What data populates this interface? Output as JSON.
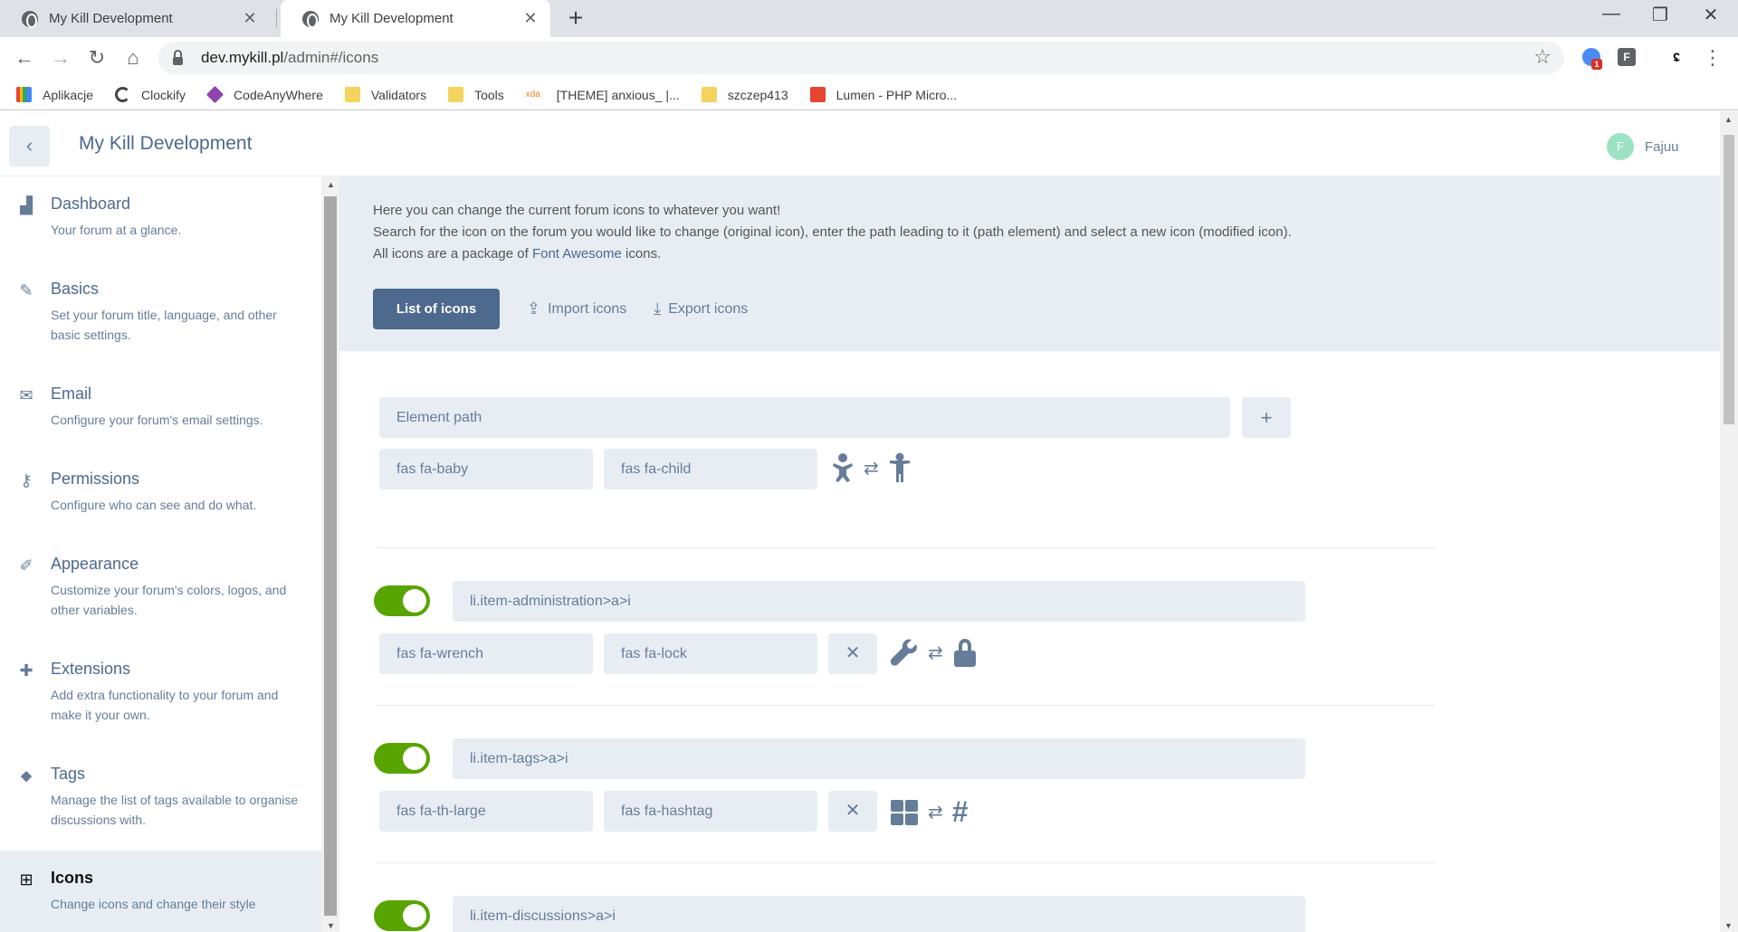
{
  "browser": {
    "tabs": [
      {
        "title": "My Kill Development",
        "active": false
      },
      {
        "title": "My Kill Development",
        "active": true
      }
    ],
    "url_host": "dev.mykill.pl",
    "url_path": "/admin#/icons",
    "extension_badge": "1",
    "ext_f_label": "F",
    "bookmarks": [
      {
        "label": "Aplikacje",
        "icon": "apps-grid-icon"
      },
      {
        "label": "Clockify",
        "icon": "clockify-icon"
      },
      {
        "label": "CodeAnyWhere",
        "icon": "codeanywhere-icon"
      },
      {
        "label": "Validators",
        "icon": "folder-icon"
      },
      {
        "label": "Tools",
        "icon": "folder-icon"
      },
      {
        "label": "[THEME] anxious_ |...",
        "icon": "xda-icon"
      },
      {
        "label": "szczep413",
        "icon": "folder-icon"
      },
      {
        "label": "Lumen - PHP Micro...",
        "icon": "lumen-icon"
      }
    ]
  },
  "header": {
    "title": "My Kill Development",
    "user_name": "Fajuu",
    "user_initial": "F"
  },
  "sidebar": {
    "items": [
      {
        "label": "Dashboard",
        "desc": "Your forum at a glance.",
        "icon": "chart-icon"
      },
      {
        "label": "Basics",
        "desc": "Set your forum title, language, and other basic settings.",
        "icon": "pencil-icon"
      },
      {
        "label": "Email",
        "desc": "Configure your forum's email settings.",
        "icon": "envelope-icon"
      },
      {
        "label": "Permissions",
        "desc": "Configure who can see and do what.",
        "icon": "key-icon"
      },
      {
        "label": "Appearance",
        "desc": "Customize your forum's colors, logos, and other variables.",
        "icon": "paintbrush-icon"
      },
      {
        "label": "Extensions",
        "desc": "Add extra functionality to your forum and make it your own.",
        "icon": "puzzle-icon"
      },
      {
        "label": "Tags",
        "desc": "Manage the list of tags available to organise discussions with.",
        "icon": "tags-icon"
      },
      {
        "label": "Icons",
        "desc": "Change icons and change their style",
        "icon": "icons-icon",
        "active": true
      }
    ]
  },
  "intro": {
    "line1": "Here you can change the current forum icons to whatever you want!",
    "line2": "Search for the icon on the forum you would like to change (original icon), enter the path leading to it (path element) and select a new icon (modified icon).",
    "line3_prefix": "All icons are a package of ",
    "line3_link": "Font Awesome",
    "line3_suffix": " icons."
  },
  "buttons": {
    "list_of_icons": "List of icons",
    "import_icons": "Import icons",
    "export_icons": "Export icons"
  },
  "new_entry": {
    "path_placeholder": "Element path",
    "original": "fas fa-baby",
    "modified": "fas fa-child"
  },
  "entries": [
    {
      "enabled": true,
      "path": "li.item-administration>a>i",
      "original": "fas fa-wrench",
      "modified": "fas fa-lock"
    },
    {
      "enabled": true,
      "path": "li.item-tags>a>i",
      "original": "fas fa-th-large",
      "modified": "fas fa-hashtag"
    },
    {
      "enabled": true,
      "path": "li.item-discussions>a>i",
      "original": "",
      "modified": ""
    }
  ],
  "colors": {
    "accent": "#4d698e",
    "muted": "#667d99",
    "field_bg": "#e7edf3",
    "toggle_on": "#58a400"
  }
}
